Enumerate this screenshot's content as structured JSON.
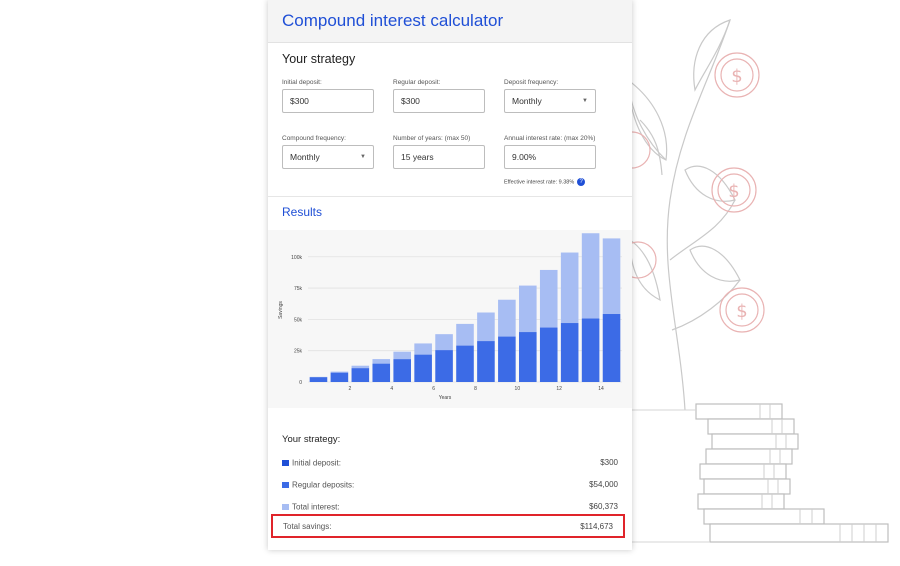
{
  "title": "Compound interest calculator",
  "strategy": {
    "heading": "Your strategy",
    "fields": {
      "initial_deposit": {
        "label": "Initial deposit:",
        "value": "$300"
      },
      "regular_deposit": {
        "label": "Regular deposit:",
        "value": "$300"
      },
      "deposit_frequency": {
        "label": "Deposit frequency:",
        "value": "Monthly"
      },
      "compound_frequency": {
        "label": "Compound frequency:",
        "value": "Monthly"
      },
      "years": {
        "label": "Number of years: (max 50)",
        "value": "15 years"
      },
      "rate": {
        "label": "Annual interest rate: (max 20%)",
        "value": "9.00%"
      }
    },
    "effective_rate": "Effective interest rate: 9.38%",
    "help_icon": "?"
  },
  "results": {
    "heading": "Results"
  },
  "chart_data": {
    "type": "bar",
    "stacked": true,
    "categories": [
      1,
      2,
      3,
      4,
      5,
      6,
      7,
      8,
      9,
      10,
      11,
      12,
      13,
      14,
      15
    ],
    "x_tick_labels": [
      "2",
      "4",
      "6",
      "8",
      "10",
      "12",
      "14"
    ],
    "y_tick_labels": [
      "0",
      "25k",
      "50k",
      "75k",
      "100k"
    ],
    "ylim": [
      0,
      115000
    ],
    "xlabel": "Years",
    "ylabel": "Savings",
    "series": [
      {
        "color": "#3c6be6",
        "values": [
          3900,
          7500,
          11100,
          14700,
          18300,
          21900,
          25500,
          29100,
          32700,
          36300,
          39900,
          43500,
          47100,
          50700,
          54300
        ]
      },
      {
        "color": "#a7bdf3",
        "values": [
          200,
          800,
          1900,
          3600,
          5900,
          8900,
          12700,
          17300,
          22800,
          29400,
          37100,
          46000,
          56300,
          68100,
          60373
        ]
      }
    ],
    "grid": true
  },
  "summary": {
    "heading": "Your strategy:",
    "rows": [
      {
        "label": "Initial deposit:",
        "value": "$300",
        "color": "#1f4fd6"
      },
      {
        "label": "Regular deposits:",
        "value": "$54,000",
        "color": "#3c6be6"
      },
      {
        "label": "Total interest:",
        "value": "$60,373",
        "color": "#a7bdf3"
      }
    ],
    "total_label": "Total savings:",
    "total_value": "$114,673",
    "highlight_color": "#e0242a"
  },
  "colors": {
    "accent": "#1f4fd6"
  }
}
